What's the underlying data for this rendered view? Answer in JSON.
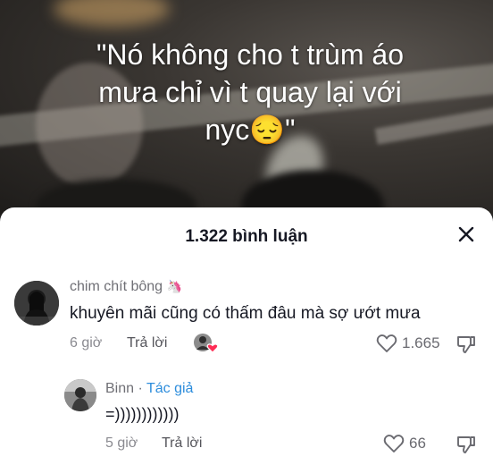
{
  "video": {
    "caption_line1": "\"Nó không cho t trùm áo",
    "caption_line2": "mưa chỉ vì t quay lại với",
    "caption_line3": "nyc😔\""
  },
  "comments_sheet": {
    "title": "1.322 bình luận",
    "close_icon": "close-icon"
  },
  "comments": [
    {
      "username": "chim chít bông",
      "username_emoji": "🦄",
      "text": "khuyên mãi cũng có thấm đâu mà sợ ướt mưa",
      "time": "6 giờ",
      "reply_label": "Trả lời",
      "like_count": "1.665",
      "creator_liked": true
    },
    {
      "username": "Binn",
      "separator": " · ",
      "author_badge": "Tác giả",
      "text": "=))))))))))))",
      "time": "5 giờ",
      "reply_label": "Trả lời",
      "like_count": "66"
    }
  ],
  "colors": {
    "author_badge": "#2d8ddc",
    "creator_like_heart": "#fe2c55",
    "text_primary": "#161823",
    "text_secondary": "#8a8a90"
  }
}
